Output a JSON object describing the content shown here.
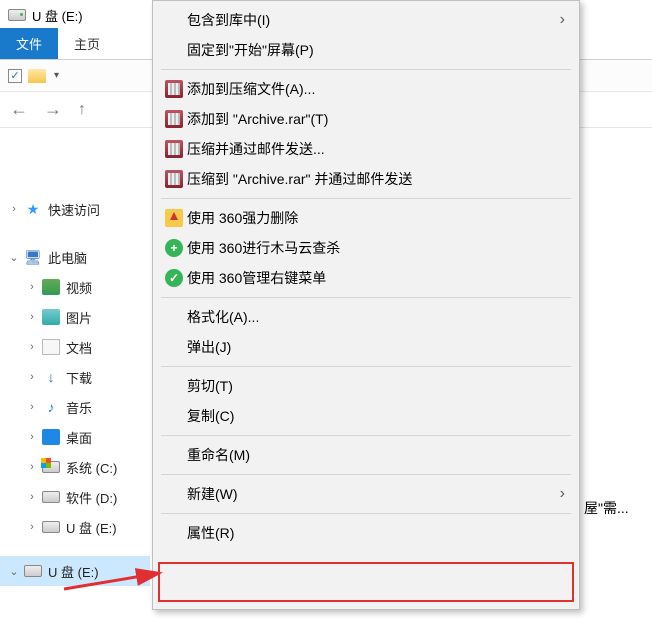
{
  "title": "U 盘 (E:)",
  "tabs": {
    "file": "文件",
    "home": "主页"
  },
  "tree": {
    "quick": "快速访问",
    "pc": "此电脑",
    "videos": "视频",
    "pictures": "图片",
    "documents": "文档",
    "downloads": "下载",
    "music": "音乐",
    "desktop": "桌面",
    "sysC": "系统 (C:)",
    "softD": "软件 (D:)",
    "usbE1": "U 盘 (E:)",
    "usbE2": "U 盘 (E:)"
  },
  "menu": {
    "includeLibrary": "包含到库中(I)",
    "pinStart": "固定到\"开始\"屏幕(P)",
    "addArchiveA": "添加到压缩文件(A)...",
    "addArchiveT": "添加到 \"Archive.rar\"(T)",
    "compressEmail": "压缩并通过邮件发送...",
    "compressArchiveEmail": "压缩到 \"Archive.rar\" 并通过邮件发送",
    "forceDel360": "使用 360强力删除",
    "trojanScan360": "使用 360进行木马云查杀",
    "manage360": "使用 360管理右键菜单",
    "formatA": "格式化(A)...",
    "ejectJ": "弹出(J)",
    "cutT": "剪切(T)",
    "copyC": "复制(C)",
    "renameM": "重命名(M)",
    "newW": "新建(W)",
    "propertiesR": "属性(R)"
  },
  "bgSnippet": "屋\"需..."
}
